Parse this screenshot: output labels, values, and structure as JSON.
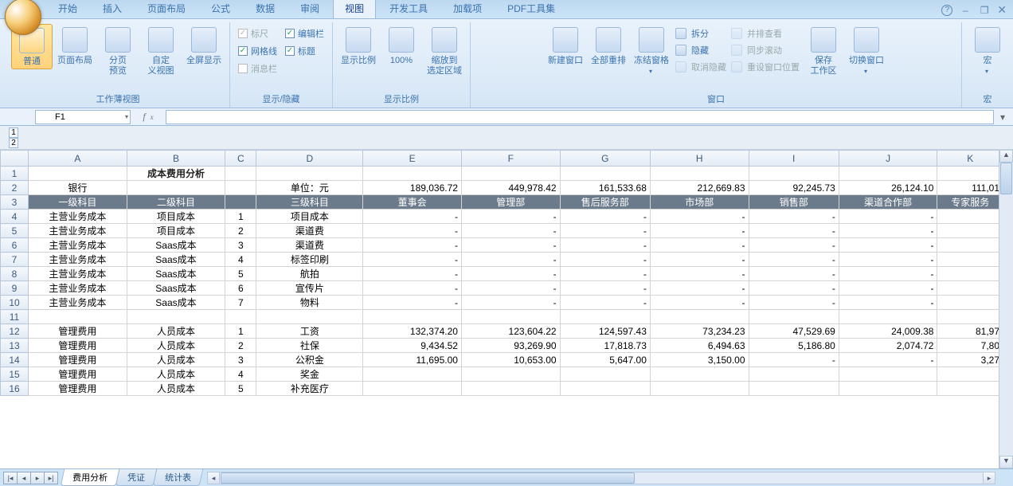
{
  "menu": {
    "tabs": [
      "开始",
      "插入",
      "页面布局",
      "公式",
      "数据",
      "审阅",
      "视图",
      "开发工具",
      "加载项",
      "PDF工具集"
    ],
    "active_index": 6
  },
  "ribbon": {
    "g_view": {
      "label": "工作薄视图",
      "b0": "普通",
      "b1": "页面布局",
      "b2": "分页\n预览",
      "b3": "自定\n义视图",
      "b4": "全屏显示"
    },
    "g_show": {
      "label": "显示/隐藏",
      "c0": "标尺",
      "c1": "网格线",
      "c2": "消息栏",
      "c3": "编辑栏",
      "c4": "标题"
    },
    "g_zoom": {
      "label": "显示比例",
      "b0": "显示比例",
      "b1": "100%",
      "b2": "缩放到\n选定区域"
    },
    "g_window": {
      "label": "窗口",
      "b0": "新建窗口",
      "b1": "全部重排",
      "b2": "冻结窗格",
      "r0": "拆分",
      "r1": "隐藏",
      "r2": "取消隐藏",
      "r3": "并排查看",
      "r4": "同步滚动",
      "r5": "重设窗口位置",
      "b3": "保存\n工作区",
      "b4": "切换窗口"
    },
    "g_macro": {
      "label": "宏",
      "b0": "宏"
    }
  },
  "namebox": {
    "value": "F1"
  },
  "outline": {
    "l0": "1",
    "l1": "2"
  },
  "columns": [
    "",
    "A",
    "B",
    "C",
    "D",
    "E",
    "F",
    "G",
    "H",
    "I",
    "J",
    "K"
  ],
  "titles": {
    "t1": "成本费用分析",
    "unit": "单位：元"
  },
  "hdr": {
    "a": "一级科目",
    "b": "二级科目",
    "d": "三级科目",
    "e": "董事会",
    "f": "管理部",
    "g": "售后服务部",
    "h": "市场部",
    "i": "销售部",
    "j": "渠道合作部",
    "k": "专家服务"
  },
  "r2": {
    "a": "银行",
    "e": "189,036.72",
    "f": "449,978.42",
    "g": "161,533.68",
    "h": "212,669.83",
    "i": "92,245.73",
    "j": "26,124.10",
    "k": "111,01"
  },
  "rows": [
    {
      "n": "4",
      "a": "主营业务成本",
      "b": "项目成本",
      "c": "1",
      "d": "项目成本"
    },
    {
      "n": "5",
      "a": "主营业务成本",
      "b": "项目成本",
      "c": "2",
      "d": "渠道费"
    },
    {
      "n": "6",
      "a": "主营业务成本",
      "b": "Saas成本",
      "c": "3",
      "d": "渠道费"
    },
    {
      "n": "7",
      "a": "主营业务成本",
      "b": "Saas成本",
      "c": "4",
      "d": "标签印刷"
    },
    {
      "n": "8",
      "a": "主营业务成本",
      "b": "Saas成本",
      "c": "5",
      "d": "航拍"
    },
    {
      "n": "9",
      "a": "主营业务成本",
      "b": "Saas成本",
      "c": "6",
      "d": "宣传片"
    },
    {
      "n": "10",
      "a": "主营业务成本",
      "b": "Saas成本",
      "c": "7",
      "d": "物料"
    }
  ],
  "rows2": [
    {
      "n": "12",
      "a": "管理费用",
      "b": "人员成本",
      "c": "1",
      "d": "工资",
      "e": "132,374.20",
      "f": "123,604.22",
      "g": "124,597.43",
      "h": "73,234.23",
      "i": "47,529.69",
      "j": "24,009.38",
      "k": "81,97"
    },
    {
      "n": "13",
      "a": "管理费用",
      "b": "人员成本",
      "c": "2",
      "d": "社保",
      "e": "9,434.52",
      "f": "93,269.90",
      "g": "17,818.73",
      "h": "6,494.63",
      "i": "5,186.80",
      "j": "2,074.72",
      "k": "7,80"
    },
    {
      "n": "14",
      "a": "管理费用",
      "b": "人员成本",
      "c": "3",
      "d": "公积金",
      "e": "11,695.00",
      "f": "10,653.00",
      "g": "5,647.00",
      "h": "3,150.00",
      "i": "-",
      "j": "-",
      "k": "3,27"
    },
    {
      "n": "15",
      "a": "管理费用",
      "b": "人员成本",
      "c": "4",
      "d": "奖金"
    },
    {
      "n": "16",
      "a": "管理费用",
      "b": "人员成本",
      "c": "5",
      "d": "补充医疗"
    }
  ],
  "dash": "-",
  "blank11": "11",
  "sheets": {
    "tabs": [
      "费用分析",
      "凭证",
      "统计表"
    ],
    "active": 0
  }
}
